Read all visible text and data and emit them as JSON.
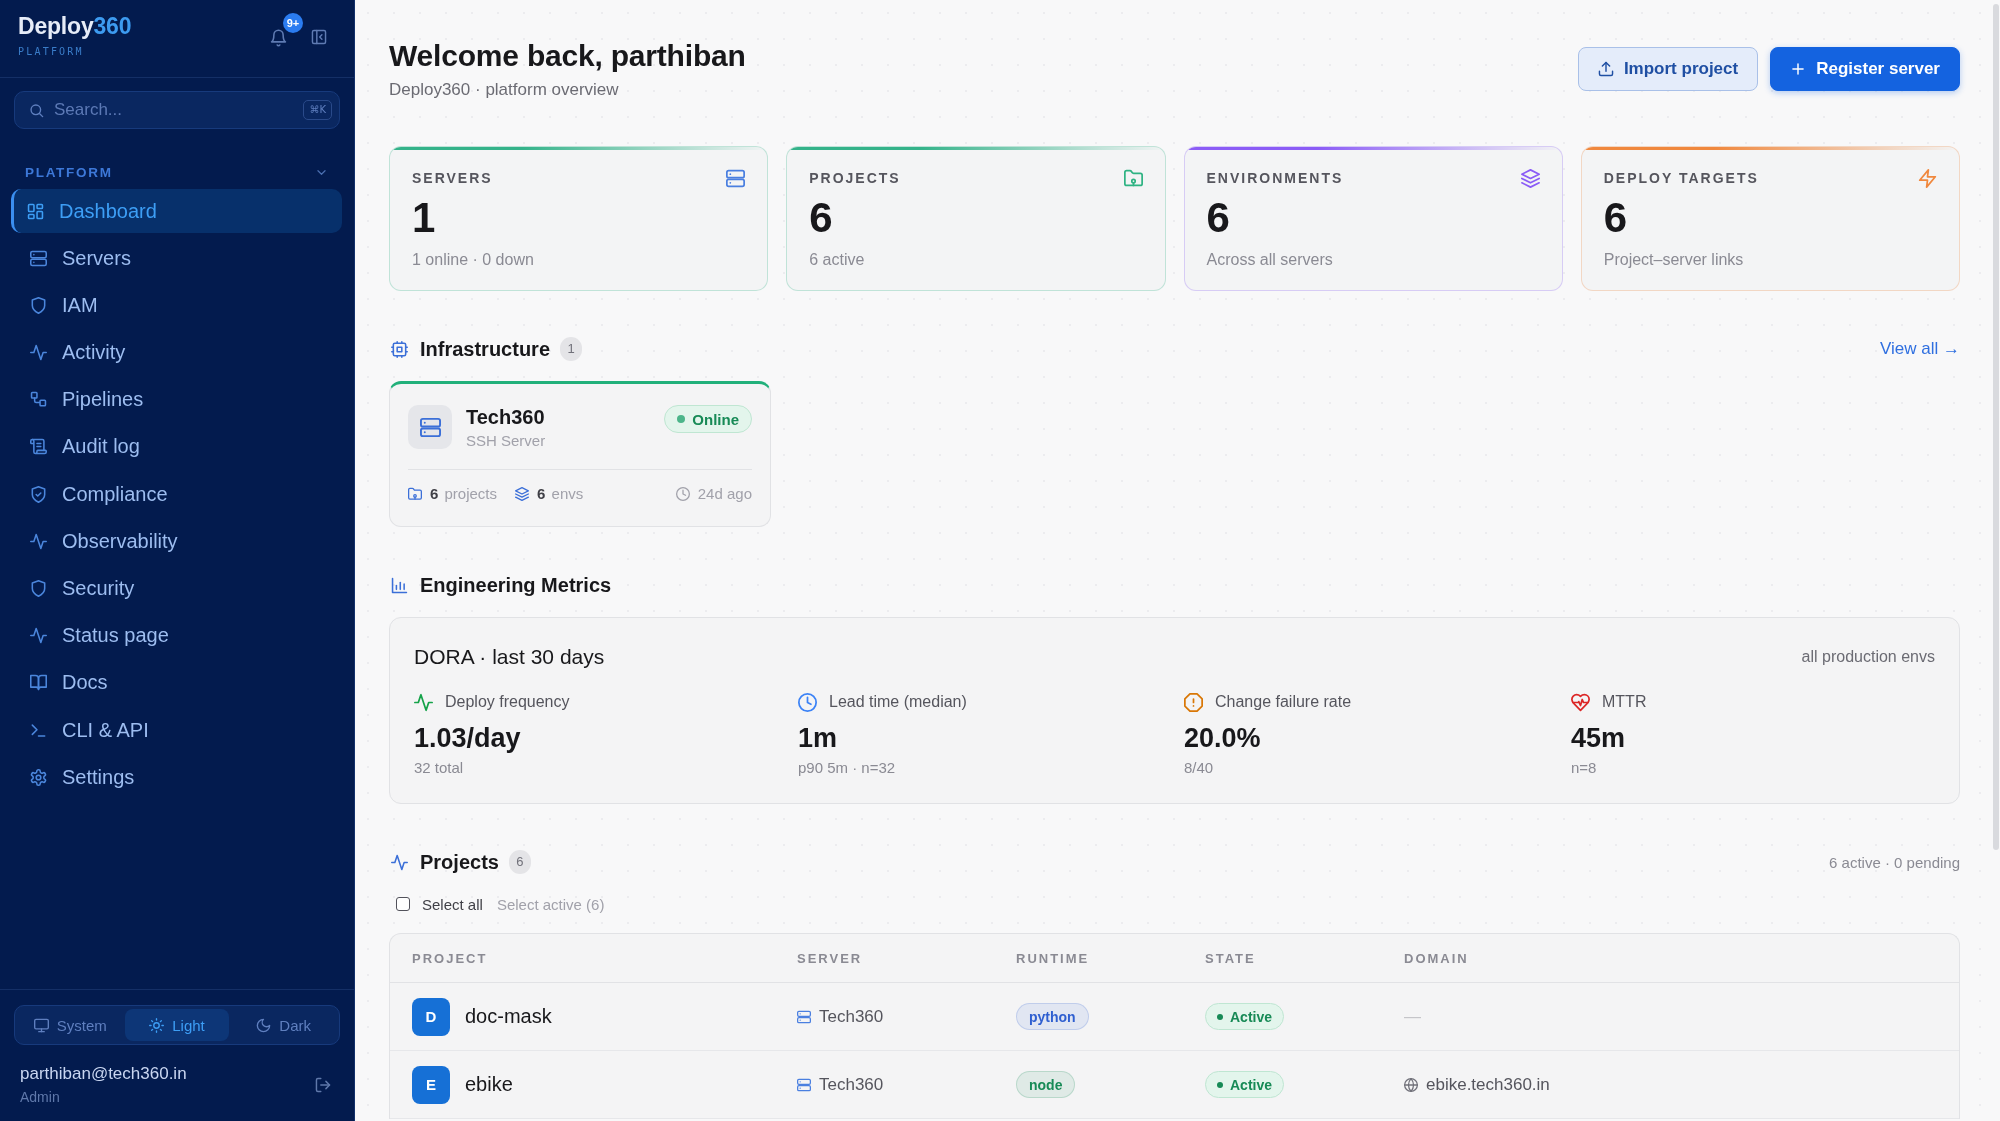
{
  "sidebar": {
    "logo": {
      "name": "Deploy",
      "accent": "360",
      "tagline": "PLATFORM"
    },
    "notification_count": "9+",
    "search": {
      "placeholder": "Search...",
      "shortcut": "⌘K"
    },
    "section": {
      "title": "PLATFORM",
      "expanded": true
    },
    "items": [
      {
        "label": "Dashboard",
        "selected": true
      },
      {
        "label": "Servers",
        "selected": false
      },
      {
        "label": "IAM",
        "selected": false
      },
      {
        "label": "Activity",
        "selected": false
      },
      {
        "label": "Pipelines",
        "selected": false
      },
      {
        "label": "Audit log",
        "selected": false
      },
      {
        "label": "Compliance",
        "selected": false
      },
      {
        "label": "Observability",
        "selected": false
      },
      {
        "label": "Security",
        "selected": false
      },
      {
        "label": "Status page",
        "selected": false
      },
      {
        "label": "Docs",
        "selected": false
      },
      {
        "label": "CLI & API",
        "selected": false
      },
      {
        "label": "Settings",
        "selected": false
      }
    ],
    "theme": {
      "options": [
        {
          "label": "System",
          "selected": false
        },
        {
          "label": "Light",
          "selected": true
        },
        {
          "label": "Dark",
          "selected": false
        }
      ]
    },
    "user": {
      "email": "parthiban@tech360.in",
      "role": "Admin"
    }
  },
  "header": {
    "title": "Welcome back, parthiban",
    "subtitle": "Deploy360 · platform overview",
    "actions": [
      {
        "label": "Import project",
        "kind": "secondary"
      },
      {
        "label": "Register server",
        "kind": "primary"
      }
    ]
  },
  "stats": [
    {
      "label": "SERVERS",
      "value": "1",
      "note": "1 online · 0 down",
      "color": "#34b38a"
    },
    {
      "label": "PROJECTS",
      "value": "6",
      "note": "6 active",
      "color": "#34b38a"
    },
    {
      "label": "ENVIRONMENTS",
      "value": "6",
      "note": "Across all servers",
      "color": "#8b5cf6"
    },
    {
      "label": "DEPLOY TARGETS",
      "value": "6",
      "note": "Project–server links",
      "color": "#f0883e"
    }
  ],
  "infrastructure": {
    "title": "Infrastructure",
    "count": "1",
    "link": "View all →",
    "servers": [
      {
        "name": "Tech360",
        "type": "SSH Server",
        "status": "Online",
        "online": true,
        "projects": "**6** projects",
        "envs": "**6** envs",
        "last_seen": "24d ago"
      }
    ]
  },
  "engineering_metrics": {
    "title": "Engineering Metrics",
    "card_title": "DORA · last 30 days",
    "scope": "all production envs",
    "items": [
      {
        "label": "Deploy frequency",
        "value": "1.03/day",
        "note": "32 total",
        "color": "#16a34a"
      },
      {
        "label": "Lead time (median)",
        "value": "1m",
        "note": "p90 5m · n=32",
        "color": "#3b82f6"
      },
      {
        "label": "Change failure rate",
        "value": "20.0%",
        "note": "8/40",
        "color": "#d97706"
      },
      {
        "label": "MTTR",
        "value": "45m",
        "note": "n=8",
        "color": "#dc2626"
      }
    ]
  },
  "projects": {
    "title": "Projects",
    "count": "6",
    "summary": "6 active · 0 pending",
    "select_all": {
      "label": "Select all",
      "checked": false
    },
    "select_active": "Select active (6)",
    "columns": [
      "PROJECT",
      "SERVER",
      "RUNTIME",
      "STATE",
      "DOMAIN"
    ],
    "rows": [
      {
        "initial": "D",
        "name": "doc-mask",
        "server": "Tech360",
        "runtime": {
          "label": "python",
          "color": "#2f5fd0"
        },
        "state": "Active",
        "active": true,
        "domain": {
          "text": "—",
          "linked": false
        }
      },
      {
        "initial": "E",
        "name": "ebike",
        "server": "Tech360",
        "runtime": {
          "label": "node",
          "color": "#178a56"
        },
        "state": "Active",
        "active": true,
        "domain": {
          "text": "ebike.tech360.in",
          "linked": true
        }
      }
    ]
  }
}
